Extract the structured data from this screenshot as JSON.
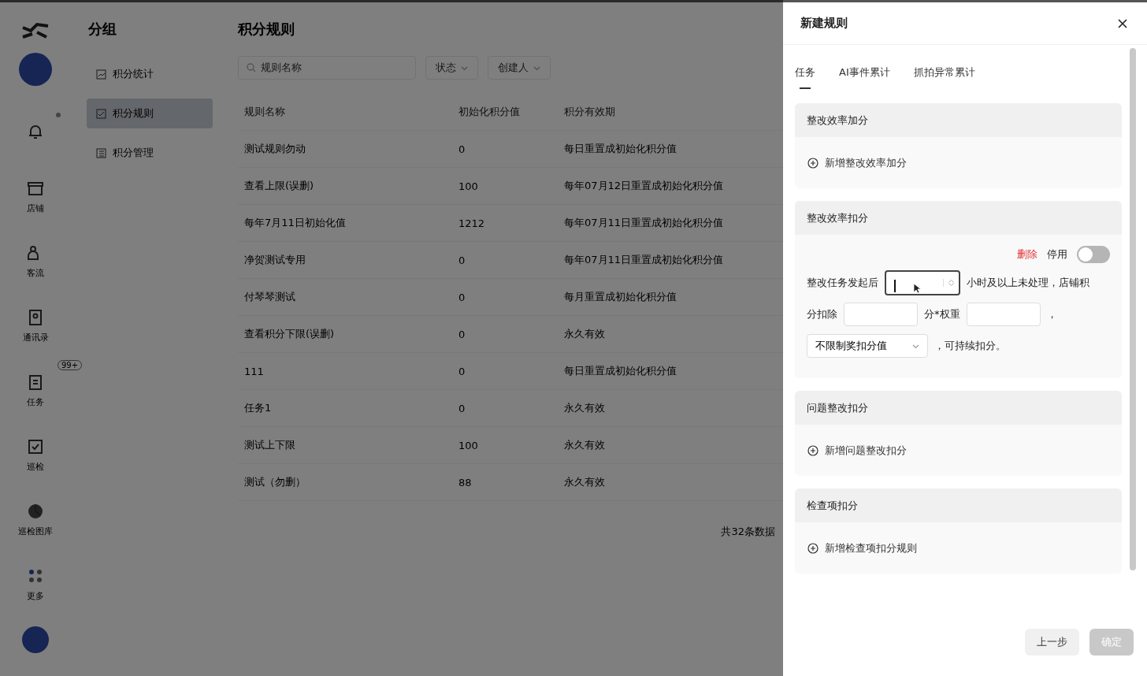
{
  "nav_rail": {
    "items": [
      {
        "kind": "bell",
        "dot": true
      },
      {
        "kind": "store",
        "label": "店铺"
      },
      {
        "kind": "people",
        "label": "客流"
      },
      {
        "kind": "contacts",
        "label": "通讯录"
      },
      {
        "kind": "task",
        "label": "任务",
        "badge": "99+"
      },
      {
        "kind": "inspect",
        "label": "巡检"
      },
      {
        "kind": "gallery",
        "label": "巡检图库"
      },
      {
        "kind": "more",
        "label": "更多"
      }
    ]
  },
  "group_panel": {
    "title": "分组",
    "items": [
      {
        "label": "积分统计",
        "selected": false
      },
      {
        "label": "积分规则",
        "selected": true
      },
      {
        "label": "积分管理",
        "selected": false
      }
    ]
  },
  "main": {
    "title": "积分规则",
    "search": {
      "placeholder": "规则名称"
    },
    "filters": [
      "状态",
      "创建人"
    ],
    "table": {
      "columns": [
        "规则名称",
        "初始化积分值",
        "积分有效期"
      ],
      "rows": [
        [
          "测试规则勿动",
          "0",
          "每日重置成初始化积分值"
        ],
        [
          "查看上限(误删)",
          "100",
          "每年07月12日重置成初始化积分值"
        ],
        [
          "每年7月11日初始化值",
          "1212",
          "每年07月11日重置成初始化积分值"
        ],
        [
          "净贺测试专用",
          "0",
          "每年07月11日重置成初始化积分值"
        ],
        [
          "付琴琴测试",
          "0",
          "每月重置成初始化积分值"
        ],
        [
          "查看积分下限(误删)",
          "0",
          "永久有效"
        ],
        [
          "111",
          "0",
          "每日重置成初始化积分值"
        ],
        [
          "任务1",
          "0",
          "永久有效"
        ],
        [
          "测试上下限",
          "100",
          "永久有效"
        ],
        [
          "测试（勿删）",
          "88",
          "永久有效"
        ]
      ]
    },
    "total": "共32条数据"
  },
  "drawer": {
    "title": "新建规则",
    "tabs": [
      {
        "label": "任务",
        "selected": true
      },
      {
        "label": "AI事件累计",
        "selected": false
      },
      {
        "label": "抓拍异常累计",
        "selected": false
      }
    ],
    "sections": [
      {
        "title": "整改效率加分",
        "kind": "add",
        "add_label": "新增整改效率加分"
      },
      {
        "title": "整改效率扣分",
        "kind": "rule",
        "delete_label": "删除",
        "toggle": {
          "label": "停用",
          "on": false
        },
        "parts": [
          {
            "kind": "text",
            "text": "整改任务发起后"
          },
          {
            "kind": "number",
            "focused": true
          },
          {
            "kind": "text",
            "text": "小时及以上未处理，店铺积"
          },
          {
            "kind": "text",
            "text": "分扣除"
          },
          {
            "kind": "input"
          },
          {
            "kind": "text",
            "text": "分*权重"
          },
          {
            "kind": "input"
          },
          {
            "kind": "text",
            "text": "，"
          },
          {
            "kind": "select",
            "value": "不限制奖扣分值"
          },
          {
            "kind": "text",
            "text": "，可持续扣分。"
          }
        ]
      },
      {
        "title": "问题整改扣分",
        "kind": "add",
        "add_label": "新增问题整改扣分"
      },
      {
        "title": "检查项扣分",
        "kind": "add",
        "add_label": "新增检查项扣分规则"
      }
    ],
    "buttons": [
      {
        "label": "上一步",
        "disabled": false
      },
      {
        "label": "确定",
        "disabled": true
      }
    ]
  }
}
